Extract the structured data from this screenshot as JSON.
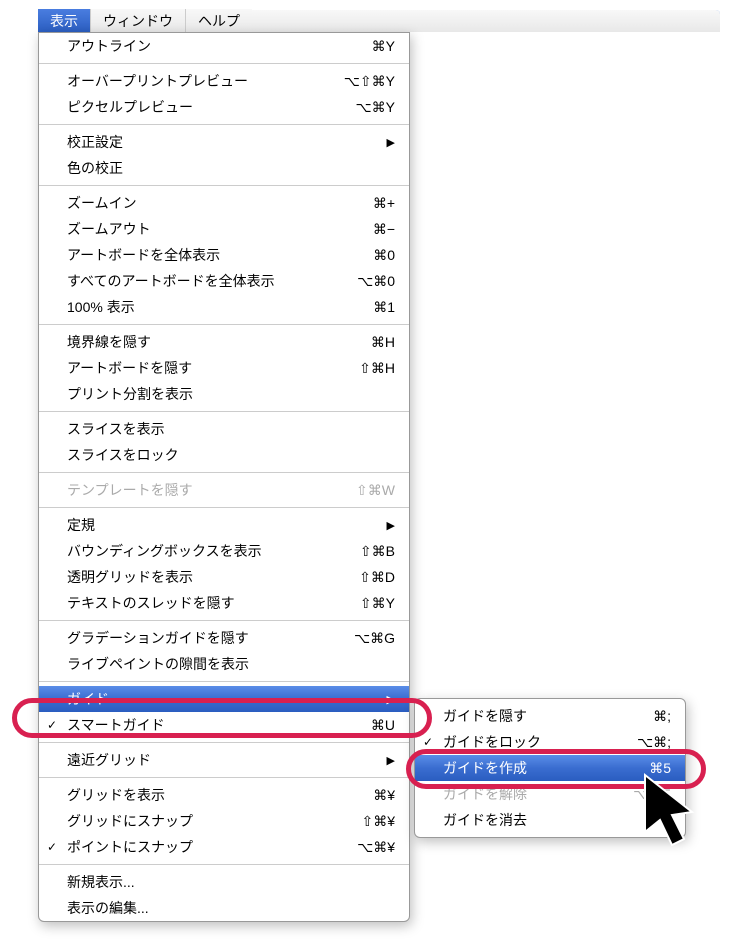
{
  "menubar": {
    "view": "表示",
    "window": "ウィンドウ",
    "help": "ヘルプ"
  },
  "menu": {
    "outline": {
      "label": "アウトライン",
      "shortcut": "⌘Y"
    },
    "overprint": {
      "label": "オーバープリントプレビュー",
      "shortcut": "⌥⇧⌘Y"
    },
    "pixelpreview": {
      "label": "ピクセルプレビュー",
      "shortcut": "⌥⌘Y"
    },
    "proofsetup": {
      "label": "校正設定"
    },
    "proofcolors": {
      "label": "色の校正"
    },
    "zoomin": {
      "label": "ズームイン",
      "shortcut": "⌘+"
    },
    "zoomout": {
      "label": "ズームアウト",
      "shortcut": "⌘−"
    },
    "fitartboard": {
      "label": "アートボードを全体表示",
      "shortcut": "⌘0"
    },
    "fitall": {
      "label": "すべてのアートボードを全体表示",
      "shortcut": "⌥⌘0"
    },
    "actual": {
      "label": "100% 表示",
      "shortcut": "⌘1"
    },
    "hideedges": {
      "label": "境界線を隠す",
      "shortcut": "⌘H"
    },
    "hideartboards": {
      "label": "アートボードを隠す",
      "shortcut": "⇧⌘H"
    },
    "showprinttiling": {
      "label": "プリント分割を表示"
    },
    "showslices": {
      "label": "スライスを表示"
    },
    "lockslices": {
      "label": "スライスをロック"
    },
    "hidetemplate": {
      "label": "テンプレートを隠す",
      "shortcut": "⇧⌘W"
    },
    "rulers": {
      "label": "定規"
    },
    "showbbox": {
      "label": "バウンディングボックスを表示",
      "shortcut": "⇧⌘B"
    },
    "showtransgrid": {
      "label": "透明グリッドを表示",
      "shortcut": "⇧⌘D"
    },
    "hidetextthreads": {
      "label": "テキストのスレッドを隠す",
      "shortcut": "⇧⌘Y"
    },
    "hidegradient": {
      "label": "グラデーションガイドを隠す",
      "shortcut": "⌥⌘G"
    },
    "showlivepaint": {
      "label": "ライブペイントの隙間を表示"
    },
    "guides": {
      "label": "ガイド"
    },
    "smartguides": {
      "label": "スマートガイド",
      "shortcut": "⌘U"
    },
    "perspective": {
      "label": "遠近グリッド"
    },
    "showgrid": {
      "label": "グリッドを表示",
      "shortcut": "⌘¥"
    },
    "snapgrid": {
      "label": "グリッドにスナップ",
      "shortcut": "⇧⌘¥"
    },
    "snappoint": {
      "label": "ポイントにスナップ",
      "shortcut": "⌥⌘¥"
    },
    "newview": {
      "label": "新規表示..."
    },
    "editviews": {
      "label": "表示の編集..."
    }
  },
  "submenu": {
    "hideguides": {
      "label": "ガイドを隠す",
      "shortcut": "⌘;"
    },
    "lockguides": {
      "label": "ガイドをロック",
      "shortcut": "⌥⌘;"
    },
    "makeguides": {
      "label": "ガイドを作成",
      "shortcut": "⌘5"
    },
    "releaseguides": {
      "label": "ガイドを解除",
      "shortcut": "⌥⌘5"
    },
    "clearguides": {
      "label": "ガイドを消去"
    }
  },
  "arrow": "▶",
  "check": "✓"
}
